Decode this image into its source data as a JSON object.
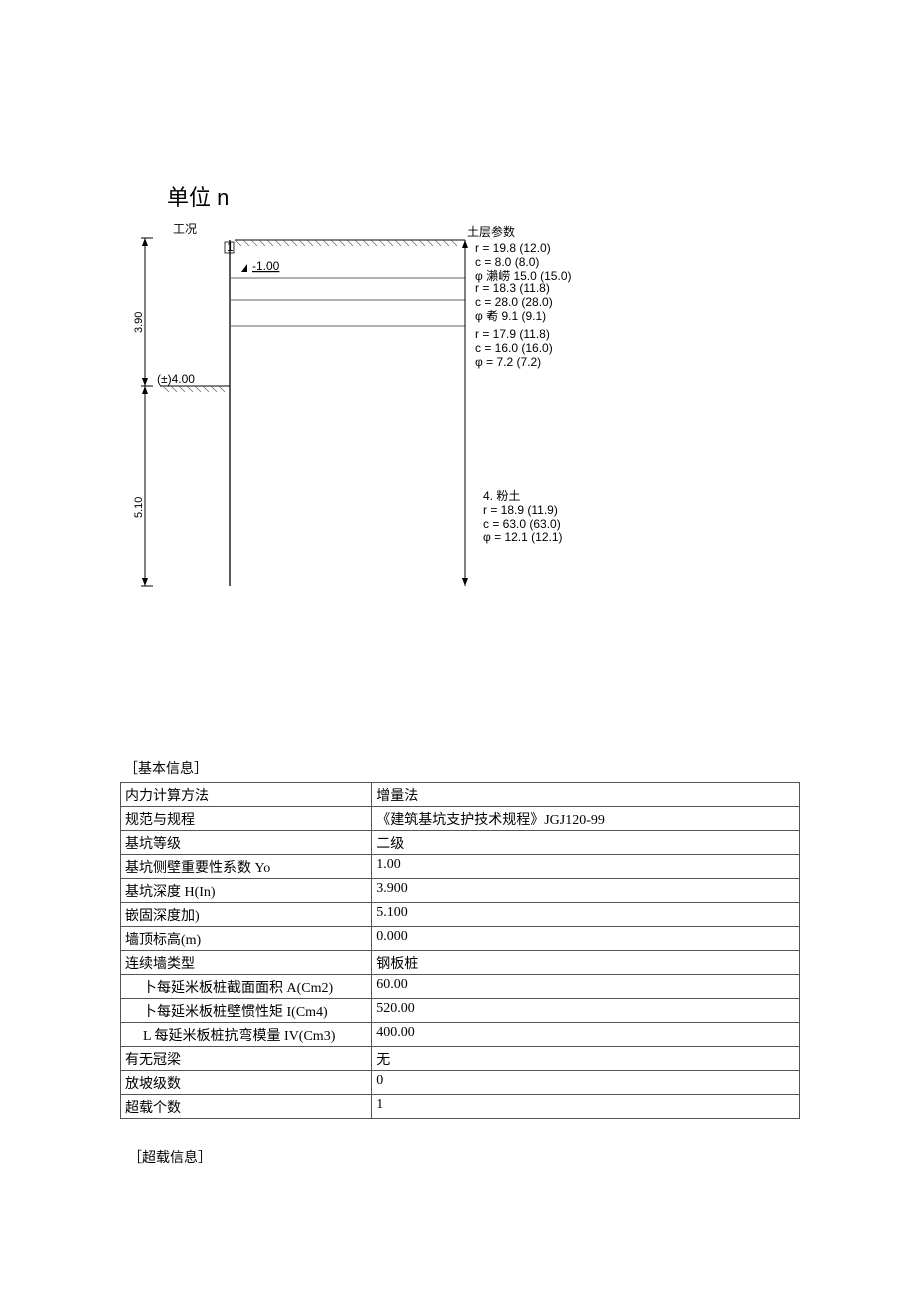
{
  "diagram": {
    "title": "单位 n",
    "top_left_label": "工况",
    "top_right_label": "土层参数",
    "marker_text": "-1.00",
    "bottom_marker": "(±)4.00",
    "left_dim_upper": "3.90",
    "left_dim_lower": "5.10",
    "layer1_r": "r  =  19.8  (12.0)",
    "layer1_c": "c  =  8.0  (8.0)",
    "layer1_phi": "φ  瀨崂 15.0  (15.0)",
    "layer2_r": "r  =  18.3  (11.8)",
    "layer2_c": "c  =  28.0  (28.0)",
    "layer2_phi": "φ  耇 9.1  (9.1)",
    "layer3_r": "r  =  17.9  (11.8)",
    "layer3_c": "c  =  16.0  (16.0)",
    "layer3_phi": "φ  =  7.2  (7.2)",
    "layer4_title": "4. 粉土",
    "layer4_r": "r  =  18.9  (11.9)",
    "layer4_c": "c  =  63.0  (63.0)",
    "layer4_phi": "φ  =  12.1  (12.1)"
  },
  "basic_info": {
    "heading": "［基本信息］",
    "rows": [
      {
        "label": "内力计算方法",
        "value": "增量法",
        "indent": false
      },
      {
        "label": "规范与规程",
        "value": "《建筑基坑支护技术规程》JGJ120-99",
        "indent": false
      },
      {
        "label": "基坑等级",
        "value": "二级",
        "indent": false
      },
      {
        "label": "基坑侧壁重要性系数 Yo",
        "value": "1.00",
        "indent": false
      },
      {
        "label": "基坑深度 H(In)",
        "value": "3.900",
        "indent": false
      },
      {
        "label": "嵌固深度加)",
        "value": "5.100",
        "indent": false
      },
      {
        "label": "墙顶标高(m)",
        "value": "0.000",
        "indent": false
      },
      {
        "label": "连续墙类型",
        "value": "钢板桩",
        "indent": false
      },
      {
        "label": "卜每延米板桩截面面积 A(Cm2)",
        "value": "60.00",
        "indent": true
      },
      {
        "label": "卜每延米板桩壁惯性矩 I(Cm4)",
        "value": "520.00",
        "indent": true
      },
      {
        "label": "L 每延米板桩抗弯模量 IV(Cm3)",
        "value": "400.00",
        "indent": true
      },
      {
        "label": "有无冠梁",
        "value": "无",
        "indent": false
      },
      {
        "label": "放坡级数",
        "value": "0",
        "indent": false
      },
      {
        "label": "超载个数",
        "value": "1",
        "indent": false
      }
    ]
  },
  "overload": {
    "heading": "［超载信息］"
  }
}
